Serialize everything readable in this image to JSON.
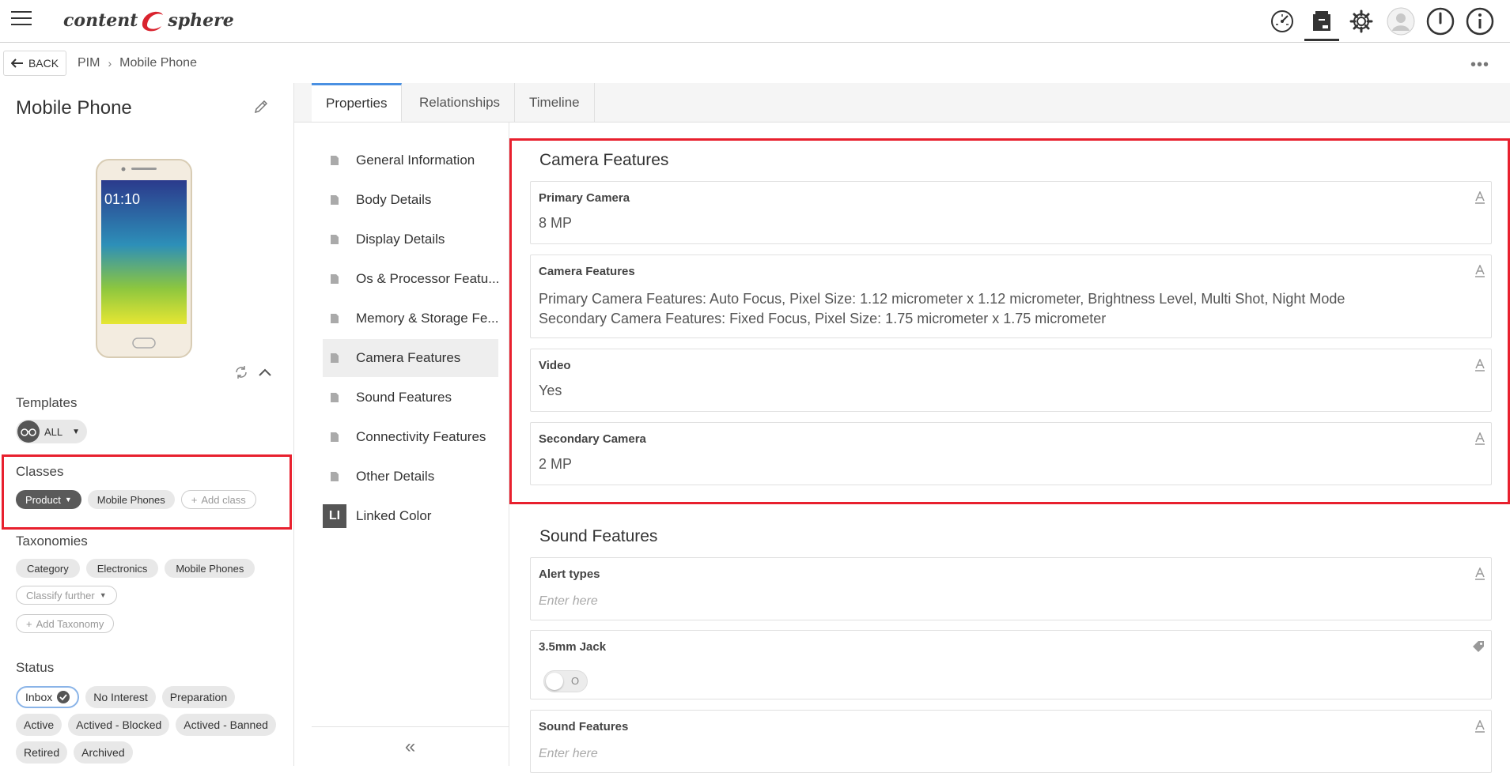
{
  "app": {
    "logo_left": "content",
    "logo_right": "sphere"
  },
  "topbar": {
    "icons": [
      "dashboard-gauge-icon",
      "product-box-icon",
      "settings-gear-icon",
      "user-avatar-icon",
      "power-icon",
      "info-icon"
    ]
  },
  "breadcrumb": {
    "back_label": "BACK",
    "items": [
      "PIM",
      "Mobile Phone"
    ]
  },
  "product": {
    "title": "Mobile Phone",
    "phone_time": "01:10",
    "templates_label": "Templates",
    "templates_chip": "ALL",
    "classes_label": "Classes",
    "classes": [
      "Product",
      "Mobile Phones"
    ],
    "add_class": "Add class",
    "taxonomies_label": "Taxonomies",
    "taxonomies": [
      "Category",
      "Electronics",
      "Mobile Phones"
    ],
    "classify_further": "Classify further",
    "add_taxonomy": "Add Taxonomy",
    "status_label": "Status",
    "statuses": [
      "Inbox",
      "No Interest",
      "Preparation",
      "Active",
      "Actived - Blocked",
      "Actived - Banned",
      "Retired",
      "Archived"
    ],
    "selected_status": "Inbox"
  },
  "tabs": [
    "Properties",
    "Relationships",
    "Timeline"
  ],
  "active_tab": "Properties",
  "nav": {
    "items": [
      "General Information",
      "Body Details",
      "Display Details",
      "Os & Processor Featu...",
      "Memory & Storage Fe...",
      "Camera Features",
      "Sound Features",
      "Connectivity Features",
      "Other Details",
      "Linked Color"
    ],
    "active": "Camera Features",
    "linked_badge": "LI"
  },
  "camera": {
    "title": "Camera Features",
    "primary_label": "Primary Camera",
    "primary_value": "8 MP",
    "features_label": "Camera Features",
    "features_line1": "Primary Camera Features: Auto Focus, Pixel Size: 1.12 micrometer x 1.12 micrometer, Brightness Level, Multi Shot, Night Mode",
    "features_line2": "Secondary Camera Features: Fixed Focus, Pixel Size: 1.75 micrometer x 1.75 micrometer",
    "video_label": "Video",
    "video_value": "Yes",
    "secondary_label": "Secondary Camera",
    "secondary_value": "2 MP"
  },
  "sound": {
    "title": "Sound Features",
    "alert_label": "Alert types",
    "alert_placeholder": "Enter here",
    "jack_label": "3.5mm Jack",
    "jack_toggle_text": "O",
    "features_label": "Sound Features",
    "features_placeholder": "Enter here"
  },
  "colors": {
    "accent_red": "#e8202e",
    "tab_blue": "#4a90e2",
    "chip_dark": "#5a5a5a"
  }
}
